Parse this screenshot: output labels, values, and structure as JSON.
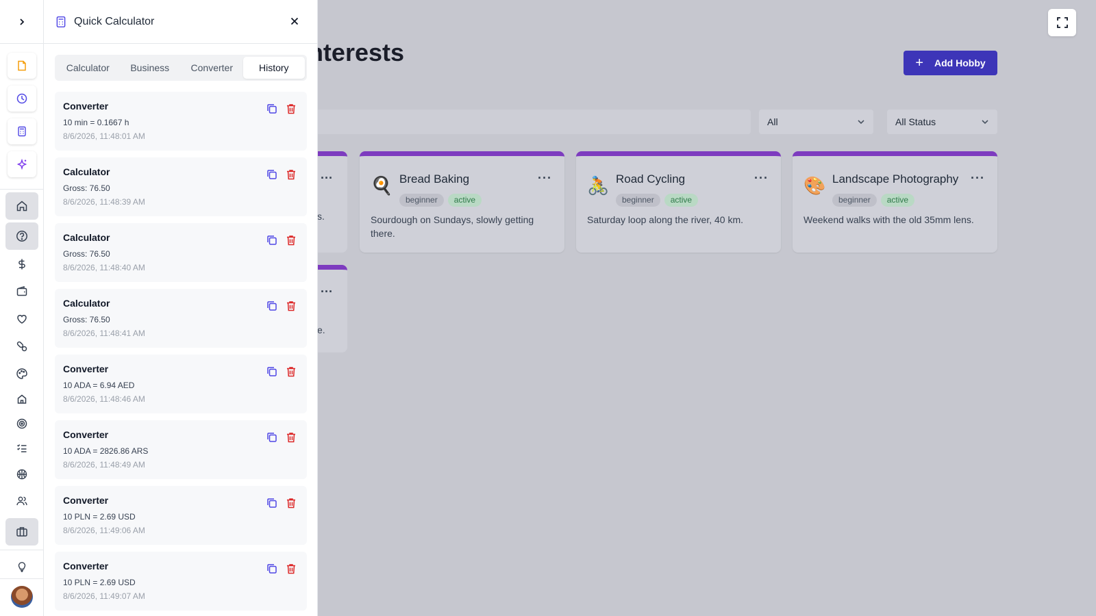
{
  "page": {
    "title_fragment": "nterests",
    "add_button_label": "Add Hobby",
    "filter_category": "All",
    "filter_status": "All Status",
    "cards": [
      {
        "emoji": "🍳",
        "name": "Bread Baking",
        "level": "beginner",
        "status": "active",
        "description": "Sourdough on Sundays, slowly getting there."
      },
      {
        "emoji": "🚴",
        "name": "Road Cycling",
        "level": "beginner",
        "status": "active",
        "description": "Saturday loop along the river, 40 km."
      },
      {
        "emoji": "🎨",
        "name": "Landscape Photography",
        "level": "beginner",
        "status": "active",
        "description": "Weekend walks with the old 35mm lens."
      }
    ],
    "partial_card_texts": [
      "s.",
      "e."
    ],
    "more_label": "···"
  },
  "rail": {
    "expand_icon": "chevron-right-icon",
    "quick_icons": [
      "file-icon",
      "clock-icon",
      "calculator-icon",
      "sparkles-icon"
    ],
    "nav_icons": [
      "home-icon",
      "help-circle-icon",
      "dollar-icon",
      "wallet-icon",
      "heart-icon",
      "pill-icon",
      "palette-icon",
      "house-icon",
      "target-icon",
      "list-check-icon",
      "basketball-icon",
      "users-icon",
      "briefcase-icon",
      "lightbulb-icon"
    ],
    "accent_color": "#f59e0b"
  },
  "calculator": {
    "title": "Quick Calculator",
    "tabs": [
      "Calculator",
      "Business",
      "Converter",
      "History"
    ],
    "active_tab": "History",
    "history": [
      {
        "type": "Converter",
        "value": "10 min = 0.1667 h",
        "time": "8/6/2026, 11:48:01 AM"
      },
      {
        "type": "Calculator",
        "value": "Gross: 76.50",
        "time": "8/6/2026, 11:48:39 AM"
      },
      {
        "type": "Calculator",
        "value": "Gross: 76.50",
        "time": "8/6/2026, 11:48:40 AM"
      },
      {
        "type": "Calculator",
        "value": "Gross: 76.50",
        "time": "8/6/2026, 11:48:41 AM"
      },
      {
        "type": "Converter",
        "value": "10 ADA = 6.94 AED",
        "time": "8/6/2026, 11:48:46 AM"
      },
      {
        "type": "Converter",
        "value": "10 ADA = 2826.86 ARS",
        "time": "8/6/2026, 11:48:49 AM"
      },
      {
        "type": "Converter",
        "value": "10 PLN = 2.69 USD",
        "time": "8/6/2026, 11:49:06 AM"
      },
      {
        "type": "Converter",
        "value": "10 PLN = 2.69 USD",
        "time": "8/6/2026, 11:49:07 AM"
      }
    ],
    "copy_color": "#4f46e5",
    "delete_color": "#dc2626"
  }
}
